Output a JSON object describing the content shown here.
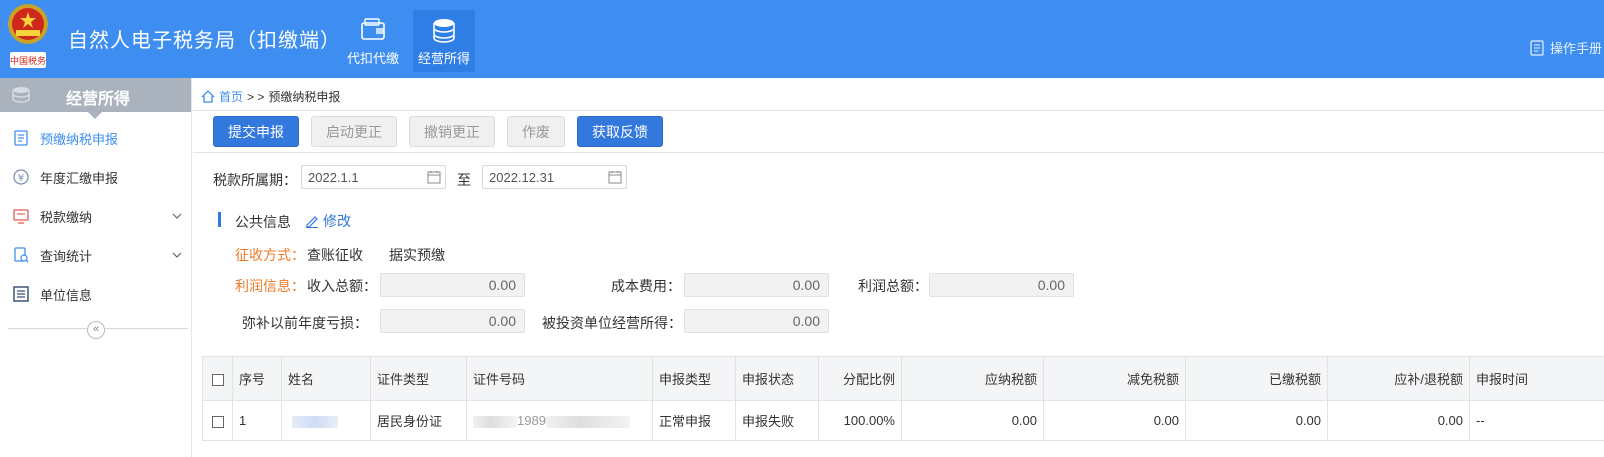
{
  "header": {
    "title": "自然人电子税务局（扣缴端）",
    "tabs": [
      {
        "label": "代扣代缴",
        "icon": "wallet-icon"
      },
      {
        "label": "经营所得",
        "icon": "coins-icon"
      }
    ],
    "manual_label": "操作手册"
  },
  "sidebar": {
    "title": "经营所得",
    "items": [
      {
        "label": "预缴纳税申报",
        "icon": "document-icon"
      },
      {
        "label": "年度汇缴申报",
        "icon": "yen-icon"
      },
      {
        "label": "税款缴纳",
        "icon": "monitor-icon"
      },
      {
        "label": "查询统计",
        "icon": "search-doc-icon"
      },
      {
        "label": "单位信息",
        "icon": "list-icon"
      }
    ],
    "collapse_glyph": "«"
  },
  "breadcrumb": {
    "home": "首页",
    "separator": "> >",
    "current": "预缴纳税申报"
  },
  "toolbar": {
    "submit": "提交申报",
    "start_correction": "启动更正",
    "cancel_correction": "撤销更正",
    "void": "作废",
    "get_feedback": "获取反馈"
  },
  "period": {
    "label": "税款所属期：",
    "start": "2022.1.1",
    "to": "至",
    "end": "2022.12.31"
  },
  "public_info": {
    "title": "公共信息",
    "edit": "修改",
    "collection_label": "征收方式：",
    "collection_value": "查账征收",
    "prepay_value": "据实预缴",
    "profit_label": "利润信息：",
    "income_label": "收入总额：",
    "income_value": "0.00",
    "cost_label": "成本费用：",
    "cost_value": "0.00",
    "profit_total_label": "利润总额：",
    "profit_total_value": "0.00",
    "loss_label": "弥补以前年度亏损：",
    "loss_value": "0.00",
    "invest_label": "被投资单位经营所得：",
    "invest_value": "0.00"
  },
  "table": {
    "headers": [
      "序号",
      "姓名",
      "证件类型",
      "证件号码",
      "申报类型",
      "申报状态",
      "分配比例",
      "应纳税额",
      "减免税额",
      "已缴税额",
      "应补/退税额",
      "申报时间"
    ],
    "rows": [
      {
        "index": "1",
        "id_type": "居民身份证",
        "id_fragment": "1989",
        "decl_type": "正常申报",
        "status": "申报失败",
        "ratio": "100.00%",
        "tax_payable": "0.00",
        "tax_reduced": "0.00",
        "tax_paid": "0.00",
        "tax_refund": "0.00",
        "time": "--"
      }
    ]
  }
}
